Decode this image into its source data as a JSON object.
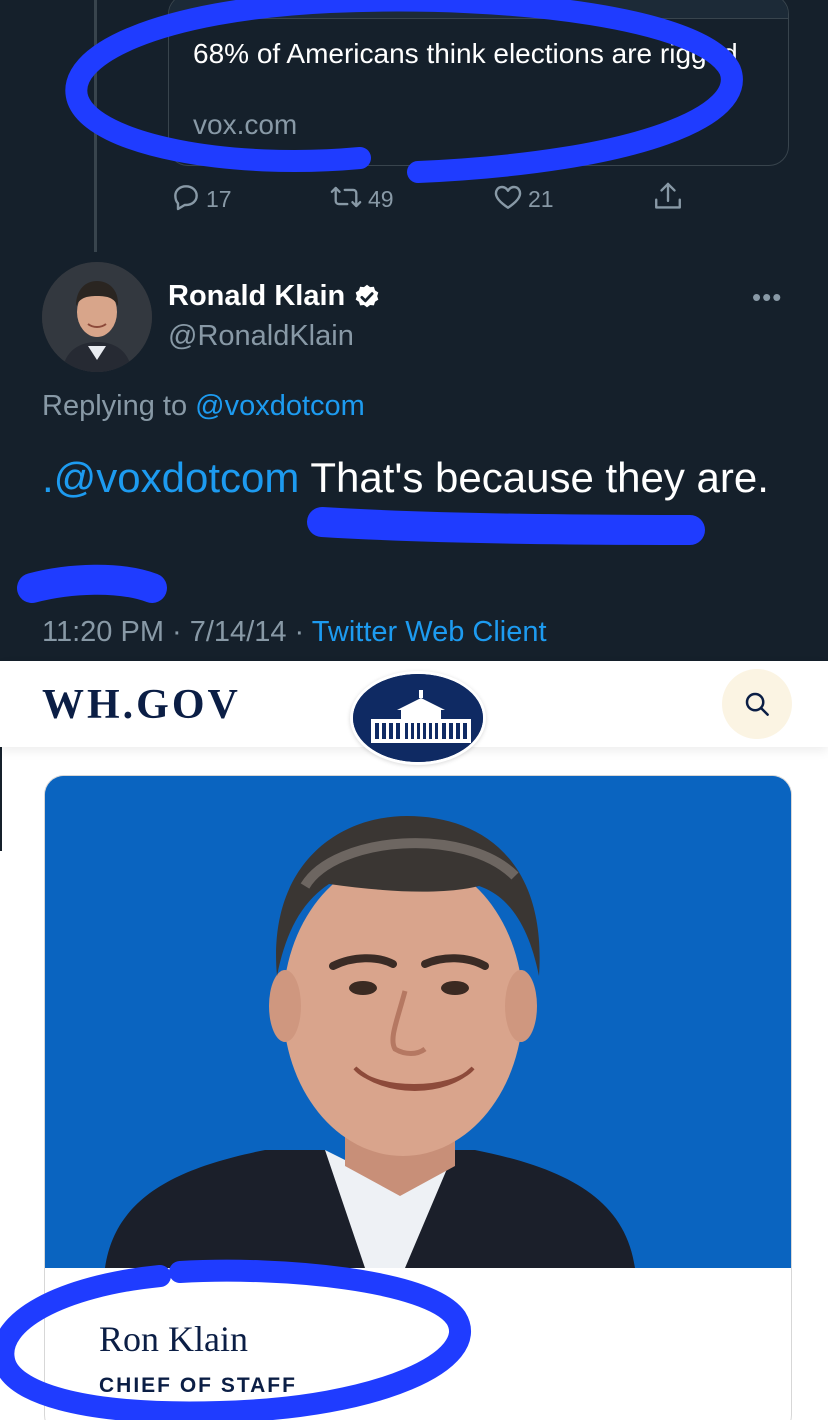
{
  "tweet": {
    "link_card": {
      "title": "68% of Americans think elections are rigged",
      "domain": "vox.com"
    },
    "actions": {
      "replies": "17",
      "retweets": "49",
      "likes": "21"
    },
    "author": {
      "display_name": "Ronald Klain",
      "handle": "@RonaldKlain",
      "verified": true
    },
    "more_label": "•••",
    "replying": {
      "prefix": "Replying to ",
      "mention": "@voxdotcom"
    },
    "text": {
      "mention": ".@voxdotcom",
      "body": " That's because they are."
    },
    "meta": {
      "time_date": "11:20 PM · 7/14/14 · ",
      "client": "Twitter Web Client"
    },
    "colors": {
      "background": "#15202b",
      "link": "#1d9bf0",
      "secondary_text": "#8899a6",
      "highlight_marker": "#1f3cff"
    }
  },
  "whitehouse": {
    "logo_text": "WH.GOV",
    "search_icon": "search-icon",
    "staff_card": {
      "name": "Ron Klain",
      "role": "CHIEF OF STAFF"
    },
    "colors": {
      "navy": "#0b1e45",
      "photo_background": "#0a64c0",
      "search_bg": "#fbf4e3"
    }
  }
}
